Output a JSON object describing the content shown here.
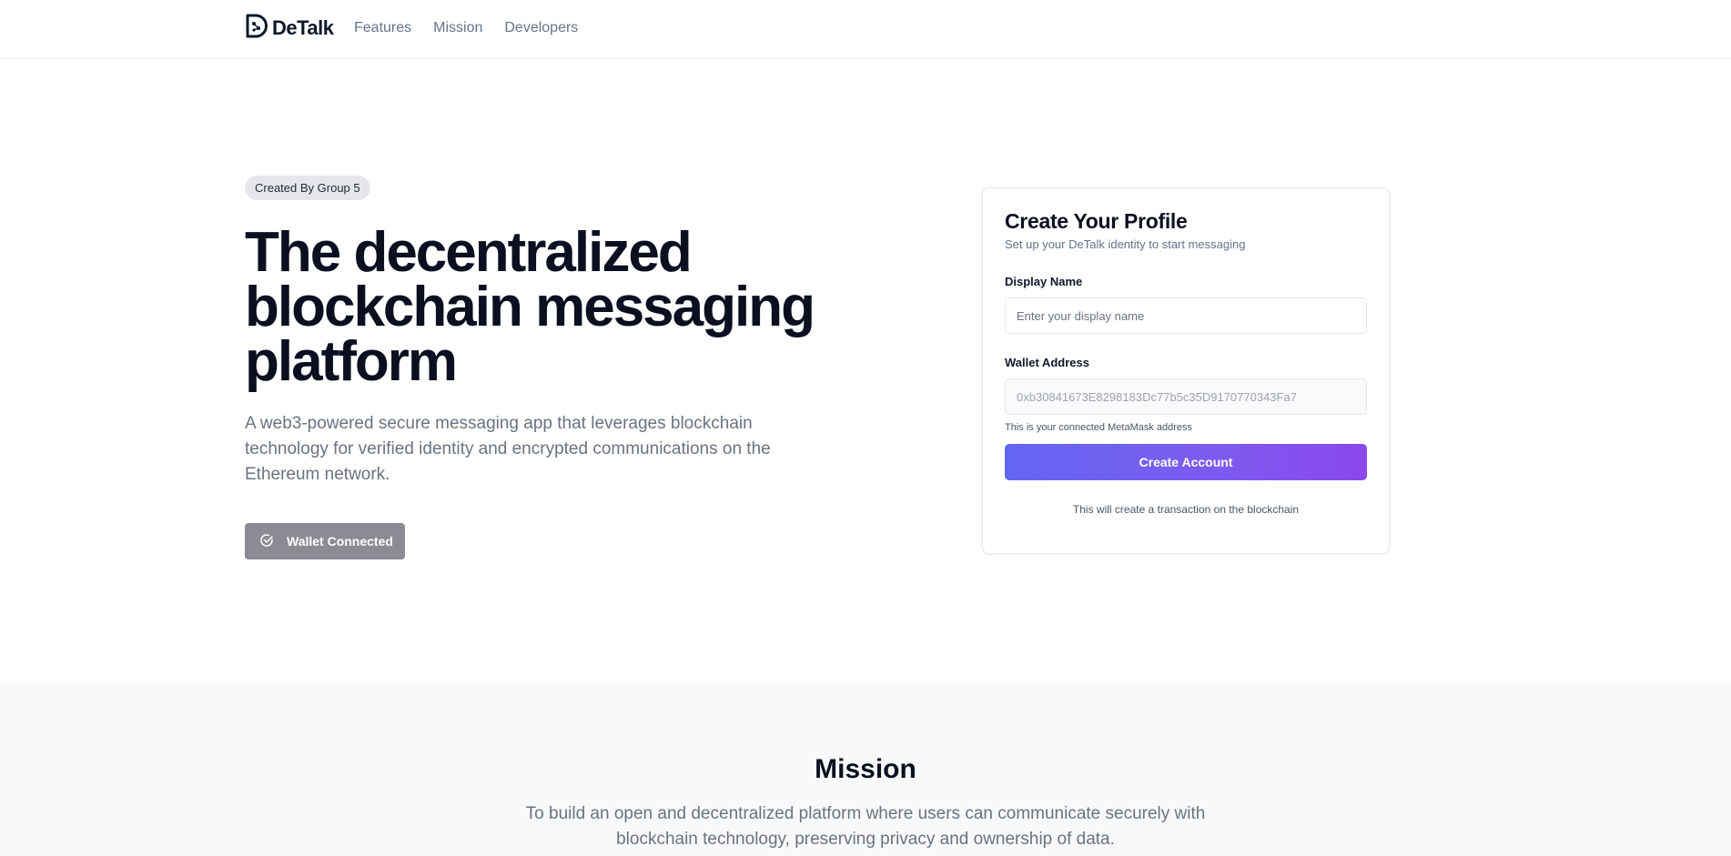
{
  "brand": {
    "name": "DeTalk"
  },
  "nav": {
    "items": [
      {
        "label": "Features"
      },
      {
        "label": "Mission"
      },
      {
        "label": "Developers"
      }
    ]
  },
  "hero": {
    "badge": "Created By Group 5",
    "headline": "The decentralized blockchain messaging platform",
    "lead": "A web3-powered secure messaging app that leverages blockchain technology for verified identity and encrypted communications on the Ethereum network.",
    "wallet_button": "Wallet Connected"
  },
  "profile_card": {
    "title": "Create Your Profile",
    "subtitle": "Set up your DeTalk identity to start messaging",
    "display_name_label": "Display Name",
    "display_name_placeholder": "Enter your display name",
    "display_name_value": "",
    "wallet_label": "Wallet Address",
    "wallet_value": "0xb30841673E8298183Dc77b5c35D9170770343Fa7",
    "wallet_hint": "This is your connected MetaMask address",
    "create_button": "Create Account",
    "note": "This will create a transaction on the blockchain"
  },
  "mission": {
    "title": "Mission",
    "text": "To build an open and decentralized platform where users can communicate securely with blockchain technology, preserving privacy and ownership of data."
  },
  "colors": {
    "accent_start": "#6366f1",
    "accent_end": "#8b47ec",
    "wallet_button_bg": "#8b8b94"
  },
  "icons": {
    "logo": "detalk-logo-icon",
    "wallet": "check-circle-icon"
  }
}
